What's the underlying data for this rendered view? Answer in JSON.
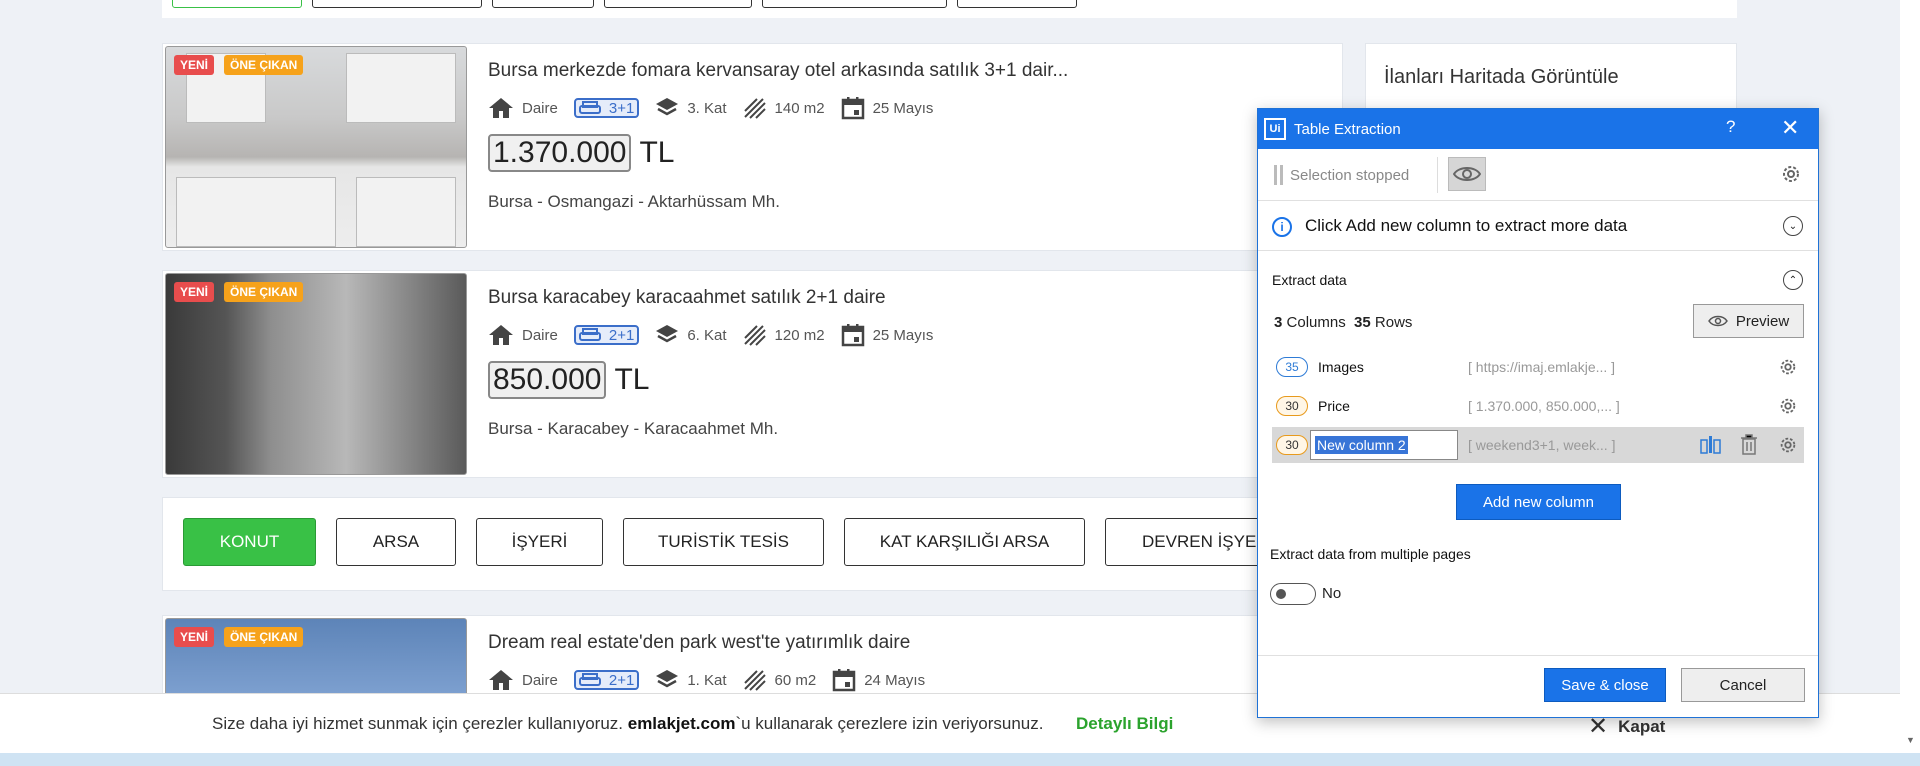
{
  "listings": [
    {
      "badge_new": "YENİ",
      "badge_featured": "ÖNE ÇIKAN",
      "title": "Bursa merkezde fomara kervansaray otel arkasında satılık 3+1 dair...",
      "type": "Daire",
      "rooms": "3+1",
      "floor": "3. Kat",
      "area": "140 m2",
      "date": "25 Mayıs",
      "price": "1.370.000",
      "currency": "TL",
      "location": "Bursa - Osmangazi - Aktarhüssam Mh."
    },
    {
      "badge_new": "YENİ",
      "badge_featured": "ÖNE ÇIKAN",
      "title": "Bursa karacabey karacaahmet satılık 2+1 daire",
      "type": "Daire",
      "rooms": "2+1",
      "floor": "6. Kat",
      "area": "120 m2",
      "date": "25 Mayıs",
      "price": "850.000",
      "currency": "TL",
      "location": "Bursa - Karacabey - Karacaahmet Mh."
    },
    {
      "badge_new": "YENİ",
      "badge_featured": "ÖNE ÇIKAN",
      "title": "Dream real estate'den park west'te yatırımlık daire",
      "type": "Daire",
      "rooms": "2+1",
      "floor": "1. Kat",
      "area": "60 m2",
      "date": "24 Mayıs"
    }
  ],
  "categories": [
    "KONUT",
    "ARSA",
    "İŞYERİ",
    "TURİSTİK TESİS",
    "KAT KARŞILIĞI ARSA",
    "DEVREN İŞYERİ"
  ],
  "right_panel": {
    "title": "İlanları Haritada Görüntüle"
  },
  "cookie": {
    "text_before": "Size daha iyi hizmet sunmak için çerezler kullanıyoruz. ",
    "site": "emlakjet.com",
    "text_after": "`u kullanarak çerezlere izin veriyorsunuz.",
    "more": "Detaylı Bilgi",
    "close": "Kapat"
  },
  "dialog": {
    "logo": "Ui",
    "title": "Table Extraction",
    "help": "?",
    "close": "✕",
    "status": "Selection stopped",
    "info": "Click Add new column to extract more data",
    "section_title": "Extract data",
    "columns_count": "3",
    "columns_label": "Columns",
    "rows_count": "35",
    "rows_label": "Rows",
    "preview": "Preview",
    "columns": [
      {
        "count": "35",
        "name": "Images",
        "value": "[ https://imaj.emlakje... ]"
      },
      {
        "count": "30",
        "name": "Price",
        "value": "[ 1.370.000, 850.000,... ]"
      },
      {
        "count": "30",
        "name": "New column 2",
        "value": "[ weekend3+1, week... ]"
      }
    ],
    "add_column": "Add new column",
    "multi_pages": "Extract data from multiple pages",
    "toggle_label": "No",
    "save": "Save & close",
    "cancel": "Cancel"
  }
}
